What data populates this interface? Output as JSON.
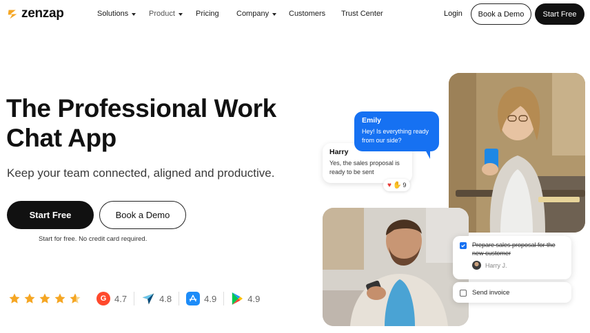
{
  "brand": {
    "name": "zenzap",
    "color": "#f5a623"
  },
  "nav": {
    "items": [
      {
        "label": "Solutions",
        "dropdown": true
      },
      {
        "label": "Product",
        "dropdown": true
      },
      {
        "label": "Pricing",
        "dropdown": false
      },
      {
        "label": "Company",
        "dropdown": true
      },
      {
        "label": "Customers",
        "dropdown": false
      },
      {
        "label": "Trust Center",
        "dropdown": false
      }
    ],
    "login": "Login",
    "book_demo": "Book a Demo",
    "start_free": "Start Free"
  },
  "hero": {
    "title_line1": "The Professional Work",
    "title_line2": "Chat App",
    "subtitle": "Keep your team connected, aligned and productive.",
    "cta_primary": "Start Free",
    "cta_secondary": "Book a Demo",
    "note": "Start for free. No credit card required."
  },
  "ratings": {
    "stars": 4.5,
    "items": [
      {
        "source": "g2",
        "icon": "g2-icon",
        "value": "4.7"
      },
      {
        "source": "capterra",
        "icon": "capterra-icon",
        "value": "4.8"
      },
      {
        "source": "app-store",
        "icon": "app-store-icon",
        "value": "4.9"
      },
      {
        "source": "google-play",
        "icon": "google-play-icon",
        "value": "4.9"
      }
    ]
  },
  "chat": {
    "harry": {
      "name": "Harry",
      "message": "Yes, the sales proposal is ready to be sent",
      "reaction_count": "9"
    },
    "emily": {
      "name": "Emily",
      "message": "Hey! Is everything ready from our side?"
    }
  },
  "tasks": [
    {
      "label": "Prepare sales proposal for the new customer",
      "done": true,
      "assignee": "Harry J."
    },
    {
      "label": "Send invoice",
      "done": false
    }
  ],
  "colors": {
    "accent_blue": "#1671f2",
    "dark": "#111111",
    "star": "#f5a623"
  }
}
